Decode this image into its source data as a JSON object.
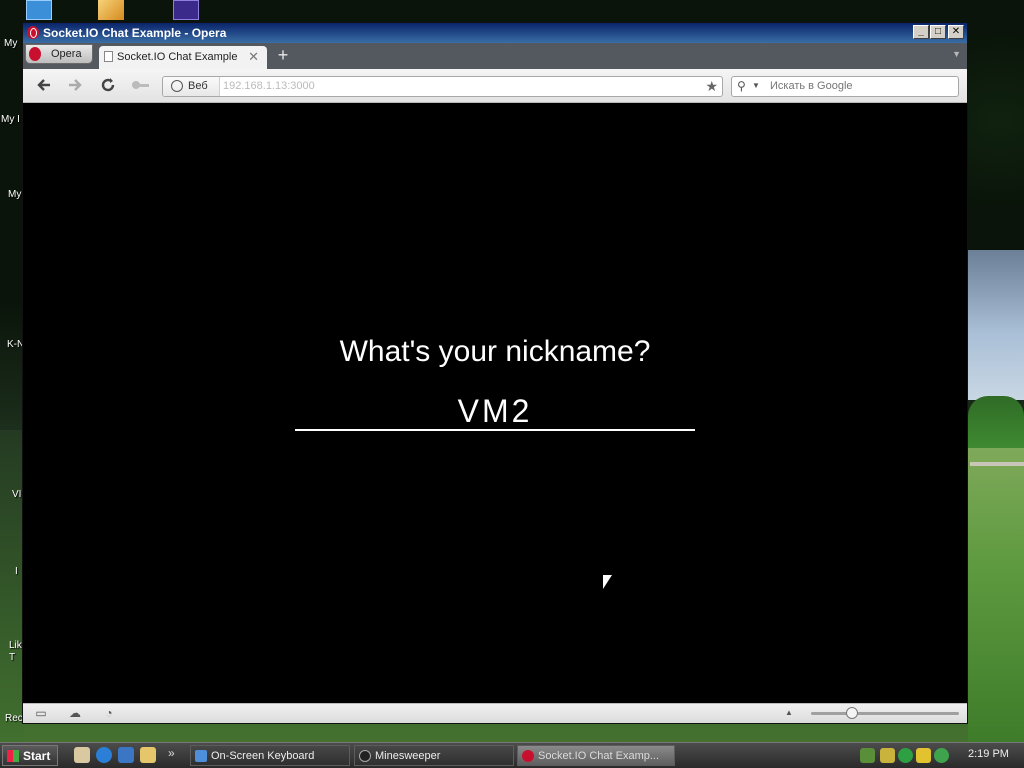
{
  "desktop": {
    "icons": [
      "My",
      "My I",
      "My",
      "K-N",
      "VI",
      "I",
      "Lik T",
      "Rec"
    ]
  },
  "window": {
    "title": "Socket.IO Chat Example - Opera",
    "controls": {
      "minimize": "_",
      "maximize": "□",
      "close": "✕"
    }
  },
  "browser": {
    "menu_label": "Opera",
    "tab": {
      "label": "Socket.IO Chat Example",
      "close": "✕"
    },
    "new_tab": "+",
    "toolbar": {
      "back_icon": "arrow-left-icon",
      "forward_icon": "arrow-right-icon",
      "reload_icon": "reload-icon",
      "key_icon": "key-icon"
    },
    "address": {
      "mode_label": "Веб",
      "url": "192.168.1.13:3000"
    },
    "search": {
      "placeholder": "Искать в Google"
    }
  },
  "page": {
    "prompt": "What's your nickname?",
    "nickname_value": "VM2"
  },
  "taskbar": {
    "start_label": "Start",
    "tasks": [
      {
        "label": "On-Screen Keyboard",
        "active": false
      },
      {
        "label": "Minesweeper",
        "active": false
      },
      {
        "label": "Socket.IO Chat Examp...",
        "active": true
      }
    ],
    "clock": "2:19 PM"
  },
  "colors": {
    "page_background": "#000000",
    "page_text": "#ffffff",
    "opera_red": "#c8102e",
    "titlebar": "#0a246a"
  }
}
